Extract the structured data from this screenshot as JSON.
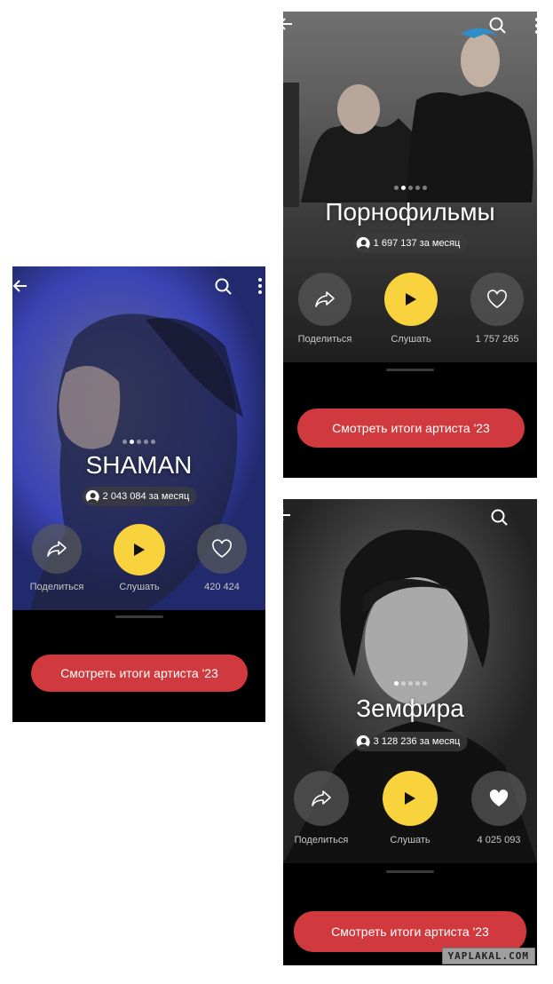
{
  "cards": {
    "shaman": {
      "artist_name": "SHAMAN",
      "listeners": "2 043 084 за месяц",
      "share_label": "Поделиться",
      "listen_label": "Слушать",
      "likes": "420 424",
      "cta_label": "Смотреть итоги артиста '23",
      "hero_color": "#3a47b8"
    },
    "pornofilmy": {
      "artist_name": "Порнофильмы",
      "listeners": "1 697 137 за месяц",
      "share_label": "Поделиться",
      "listen_label": "Слушать",
      "likes": "1 757 265",
      "cta_label": "Смотреть итоги артиста '23",
      "hero_color": "#3b3b3b"
    },
    "zemfira": {
      "artist_name": "Земфира",
      "listeners": "3 128 236 за месяц",
      "share_label": "Поделиться",
      "listen_label": "Слушать",
      "likes": "4 025 093",
      "cta_label": "Смотреть итоги артиста '23",
      "hero_color": "#2c2c2c"
    }
  },
  "watermark": "YAPLAKAL.COM",
  "colors": {
    "accent_play": "#f9d33d",
    "cta": "#d03a3e"
  },
  "icons": [
    "back-arrow-icon",
    "search-icon",
    "more-vertical-icon",
    "share-icon",
    "play-icon",
    "heart-icon",
    "person-icon"
  ]
}
